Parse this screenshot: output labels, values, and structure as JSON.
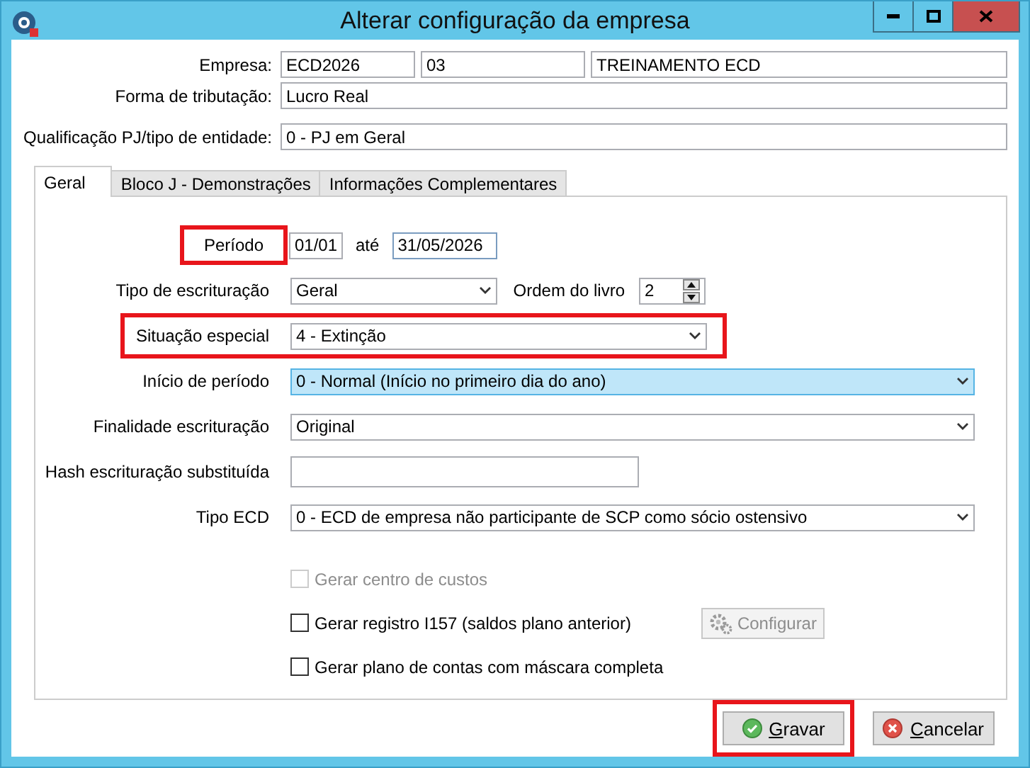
{
  "window": {
    "title": "Alterar configuração da empresa"
  },
  "header_fields": [
    {
      "label": "Empresa:",
      "values": [
        "ECD2026",
        "03",
        "TREINAMENTO ECD"
      ]
    },
    {
      "label": "Forma de tributação:",
      "values": [
        "Lucro Real"
      ]
    },
    {
      "label": "Qualificação PJ/tipo de entidade:",
      "values": [
        "0 - PJ em Geral"
      ]
    }
  ],
  "tabs": [
    {
      "label": "Geral",
      "selected": true
    },
    {
      "label": "Bloco J - Demonstrações",
      "selected": false
    },
    {
      "label": "Informações Complementares",
      "selected": false
    }
  ],
  "rows": [
    {
      "kind": "period",
      "label": "Período",
      "highlighted": true,
      "from": "01/01",
      "separator": "até",
      "to": "31/05/2026"
    },
    {
      "kind": "select_spin",
      "label": "Tipo de escrituração",
      "value": "Geral",
      "spin_label": "Ordem do livro",
      "spin_value": "2"
    },
    {
      "kind": "short_select",
      "label": "Situação especial",
      "value": "4 - Extinção",
      "highlighted": true
    },
    {
      "kind": "select",
      "label": "Início de período",
      "value": "0 - Normal (Início no primeiro dia do ano)",
      "focused": true
    },
    {
      "kind": "select",
      "label": "Finalidade escrituração",
      "value": "Original",
      "focused": false
    },
    {
      "kind": "input",
      "label": "Hash escrituração substituída"
    },
    {
      "kind": "select",
      "label": "Tipo ECD",
      "value": "0 - ECD de empresa não participante de SCP como sócio ostensivo",
      "focused": false
    }
  ],
  "checkboxes": [
    {
      "label": "Gerar centro de custos",
      "checked": false,
      "disabled": true
    },
    {
      "label": "Gerar registro I157 (saldos plano anterior)",
      "checked": false,
      "disabled": false,
      "button": {
        "label": "Configurar",
        "disabled": true
      }
    },
    {
      "label": "Gerar plano de contas com máscara completa",
      "checked": false,
      "disabled": false
    }
  ],
  "buttons": [
    {
      "label": "Gravar",
      "kind": "ok",
      "highlighted": true,
      "mnemonic": true
    },
    {
      "label": "Cancelar",
      "kind": "cancel",
      "highlighted": false,
      "mnemonic": true
    }
  ]
}
